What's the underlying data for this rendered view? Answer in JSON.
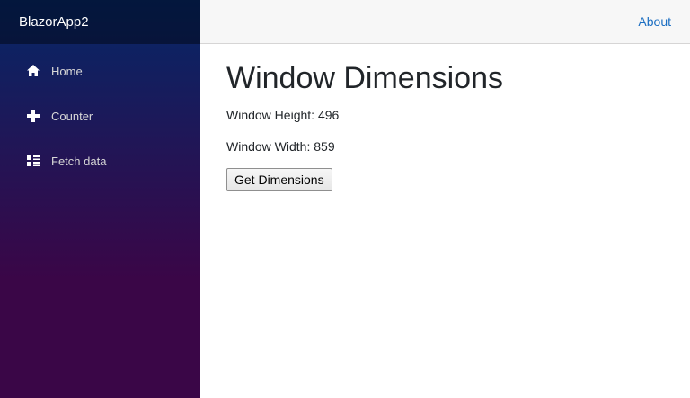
{
  "sidebar": {
    "brand": "BlazorApp2",
    "items": [
      {
        "label": "Home",
        "icon": "home-icon"
      },
      {
        "label": "Counter",
        "icon": "plus-icon"
      },
      {
        "label": "Fetch data",
        "icon": "list-rich-icon"
      }
    ]
  },
  "topbar": {
    "about_label": "About"
  },
  "main": {
    "title": "Window Dimensions",
    "height_label": "Window Height:",
    "height_value": "496",
    "width_label": "Window Width:",
    "width_value": "859",
    "button_label": "Get Dimensions"
  },
  "colors": {
    "sidebar_top": "#052767",
    "sidebar_bottom": "#3a0647",
    "link": "#1b6ec2",
    "topbar": "#f7f7f7"
  }
}
